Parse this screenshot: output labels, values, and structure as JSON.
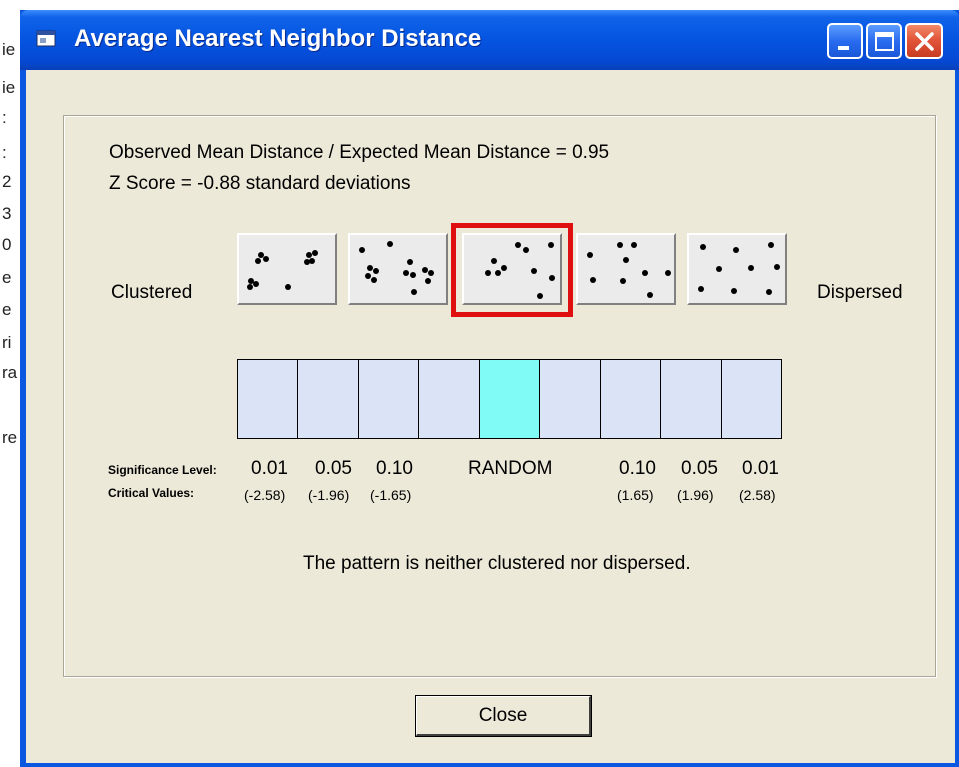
{
  "window": {
    "title": "Average Nearest Neighbor Distance"
  },
  "title_buttons": [
    "minimize-icon",
    "maximize-icon",
    "close-icon"
  ],
  "background_fragments": [
    "ie",
    "ie",
    ":",
    ":",
    "2",
    "3",
    "0",
    "e",
    "e",
    "ri",
    "ra",
    "re"
  ],
  "summary": {
    "ratio_line": "Observed Mean Distance / Expected Mean Distance = 0.95",
    "zscore_line": "Z Score = -0.88 standard deviations"
  },
  "pattern_scale": {
    "left_label": "Clustered",
    "right_label": "Dispersed",
    "selected_index": 2,
    "active_cell_index": 4
  },
  "legend": {
    "significance_label": "Significance Level:",
    "critical_label": "Critical Values:",
    "levels": [
      "0.01",
      "0.05",
      "0.10",
      "RANDOM",
      "0.10",
      "0.05",
      "0.01"
    ],
    "critical_values": [
      "(-2.58)",
      "(-1.96)",
      "(-1.65)",
      "(1.65)",
      "(1.96)",
      "(2.58)"
    ]
  },
  "result_text": "The pattern is neither clustered nor dispersed.",
  "buttons": {
    "close_label": "Close"
  },
  "colors": {
    "titlebar": "#0554e1",
    "dialog_bg": "#ece9d8",
    "scale_cell": "#dbe4f6",
    "scale_active": "#80fbf6",
    "highlight": "#e01010"
  }
}
